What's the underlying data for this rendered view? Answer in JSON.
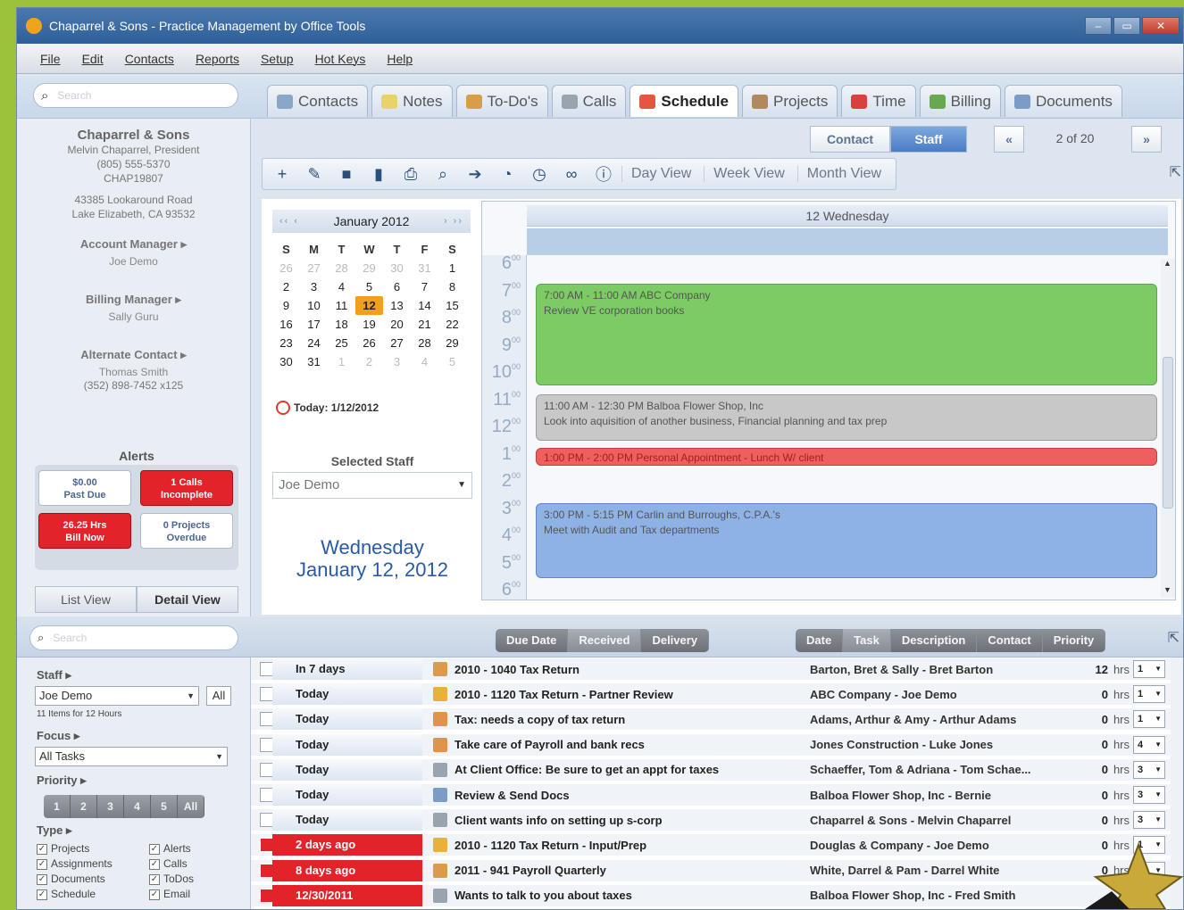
{
  "window": {
    "title": "Chaparrel & Sons - Practice Management by Office Tools"
  },
  "menu": [
    "File",
    "Edit",
    "Contacts",
    "Reports",
    "Setup",
    "Hot Keys",
    "Help"
  ],
  "search": {
    "placeholder": "Search"
  },
  "tabs": [
    {
      "label": "Contacts",
      "color": "#8aa7c8"
    },
    {
      "label": "Notes",
      "color": "#e8d36a"
    },
    {
      "label": "To-Do's",
      "color": "#d99c4a"
    },
    {
      "label": "Calls",
      "color": "#9aa4ae"
    },
    {
      "label": "Schedule",
      "color": "#e4563f",
      "active": true
    },
    {
      "label": "Projects",
      "color": "#b08a5a"
    },
    {
      "label": "Time",
      "color": "#d9413a"
    },
    {
      "label": "Billing",
      "color": "#6aa84f"
    },
    {
      "label": "Documents",
      "color": "#7a9cc6"
    }
  ],
  "contact": {
    "company": "Chaparrel & Sons",
    "person": "Melvin Chaparrel, President",
    "phone": "(805) 555-5370",
    "code": "CHAP19807",
    "address1": "43385 Lookaround Road",
    "address2": "Lake Elizabeth, CA 93532",
    "account_manager_label": "Account Manager ▸",
    "account_manager": "Joe Demo",
    "billing_manager_label": "Billing Manager ▸",
    "billing_manager": "Sally Guru",
    "alternate_label": "Alternate Contact ▸",
    "alternate_name": "Thomas Smith",
    "alternate_phone": "(352) 898-7452 x125"
  },
  "alerts": {
    "title": "Alerts",
    "past_due_amount": "$0.00",
    "past_due_label": "Past Due",
    "calls_count": "1 Calls",
    "calls_label": "Incomplete",
    "bill_hrs": "26.25 Hrs",
    "bill_label": "Bill Now",
    "projects_count": "0 Projects",
    "projects_label": "Overdue"
  },
  "views": {
    "list": "List View",
    "detail": "Detail View"
  },
  "schedule_toolbar": {
    "contact": "Contact",
    "staff": "Staff",
    "prev": "«",
    "next": "»",
    "pager": "2 of 20",
    "day_view": "Day View",
    "week_view": "Week View",
    "month_view": "Month View"
  },
  "calendar": {
    "month_label": "January 2012",
    "nav_prev": "‹‹ ‹",
    "nav_next": "› ››",
    "dow": [
      "S",
      "M",
      "T",
      "W",
      "T",
      "F",
      "S"
    ],
    "weeks": [
      [
        "26",
        "27",
        "28",
        "29",
        "30",
        "31",
        "1"
      ],
      [
        "2",
        "3",
        "4",
        "5",
        "6",
        "7",
        "8"
      ],
      [
        "9",
        "10",
        "11",
        "12",
        "13",
        "14",
        "15"
      ],
      [
        "16",
        "17",
        "18",
        "19",
        "20",
        "21",
        "22"
      ],
      [
        "23",
        "24",
        "25",
        "26",
        "27",
        "28",
        "29"
      ],
      [
        "30",
        "31",
        "1",
        "2",
        "3",
        "4",
        "5"
      ]
    ],
    "selected_day": "12",
    "today_label": "Today: 1/12/2012"
  },
  "selected_staff": {
    "label": "Selected Staff",
    "value": "Joe Demo"
  },
  "big_date": {
    "line1": "Wednesday",
    "line2": "January 12, 2012"
  },
  "day_view": {
    "header": "12 Wednesday",
    "hours": [
      "6",
      "7",
      "8",
      "9",
      "10",
      "11",
      "12",
      "1",
      "2",
      "3",
      "4",
      "5",
      "6"
    ],
    "appointments": [
      {
        "time": "7:00 AM - 11:00 AM ABC Company",
        "desc": "Review VE corporation books",
        "color": "green"
      },
      {
        "time": "11:00 AM - 12:30 PM Balboa Flower Shop, Inc",
        "desc": "Look into aquisition of another business, Financial planning and tax prep",
        "color": "gray"
      },
      {
        "time": "1:00 PM - 2:00 PM Personal Appointment - Lunch W/ client",
        "desc": "",
        "color": "red"
      },
      {
        "time": "3:00 PM - 5:15 PM Carlin and Burroughs, C.P.A.'s",
        "desc": "Meet with Audit and Tax departments",
        "color": "blue"
      }
    ]
  },
  "bottom_search": {
    "placeholder": "Search"
  },
  "sort_left": [
    "Due Date",
    "Received",
    "Delivery"
  ],
  "sort_right": [
    "Date",
    "Task",
    "Description",
    "Contact",
    "Priority"
  ],
  "filters": {
    "staff_label": "Staff ▸",
    "staff_value": "Joe Demo",
    "all": "All",
    "count_note": "11 Items for 12 Hours",
    "focus_label": "Focus ▸",
    "focus_value": "All Tasks",
    "priority_label": "Priority ▸",
    "priority_buttons": [
      "1",
      "2",
      "3",
      "4",
      "5",
      "All"
    ],
    "type_label": "Type ▸",
    "types": [
      "Projects",
      "Alerts",
      "Assignments",
      "Calls",
      "Documents",
      "ToDos",
      "Schedule",
      "Email"
    ]
  },
  "tasks": [
    {
      "when": "In 7 days",
      "task": "2010 - 1040 Tax Return",
      "contact": "Barton, Bret & Sally - Bret Barton",
      "hrs": "12",
      "unit": "hrs",
      "priority": "1",
      "late": false,
      "icon": "#d99c4a"
    },
    {
      "when": "Today",
      "task": "2010 - 1120 Tax Return - Partner Review",
      "contact": "ABC Company - Joe Demo",
      "hrs": "0",
      "unit": "hrs",
      "priority": "1",
      "late": false,
      "icon": "#e8b23a"
    },
    {
      "when": "Today",
      "task": "Tax: needs a copy of tax return",
      "contact": "Adams, Arthur & Amy - Arthur Adams",
      "hrs": "0",
      "unit": "hrs",
      "priority": "1",
      "late": false,
      "icon": "#e0934a"
    },
    {
      "when": "Today",
      "task": "Take care of Payroll and bank recs",
      "contact": "Jones Construction - Luke Jones",
      "hrs": "0",
      "unit": "hrs",
      "priority": "4",
      "late": false,
      "icon": "#e0934a"
    },
    {
      "when": "Today",
      "task": "At Client Office: Be sure to get an appt for taxes",
      "contact": "Schaeffer, Tom & Adriana - Tom Schae...",
      "hrs": "0",
      "unit": "hrs",
      "priority": "3",
      "late": false,
      "icon": "#9aa4ae"
    },
    {
      "when": "Today",
      "task": "Review & Send Docs",
      "contact": "Balboa Flower Shop, Inc - Bernie",
      "hrs": "0",
      "unit": "hrs",
      "priority": "3",
      "late": false,
      "icon": "#7a9cc6"
    },
    {
      "when": "Today",
      "task": "Client wants info on setting up s-corp",
      "contact": "Chaparrel & Sons - Melvin Chaparrel",
      "hrs": "0",
      "unit": "hrs",
      "priority": "3",
      "late": false,
      "icon": "#9aa4ae"
    },
    {
      "when": "2 days ago",
      "task": "2010 - 1120 Tax Return - Input/Prep",
      "contact": "Douglas & Company - Joe Demo",
      "hrs": "0",
      "unit": "hrs",
      "priority": "1",
      "late": true,
      "icon": "#e8b23a"
    },
    {
      "when": "8 days ago",
      "task": "2011 - 941 Payroll Quarterly",
      "contact": "White, Darrel & Pam - Darrel White",
      "hrs": "0",
      "unit": "hrs",
      "priority": "1",
      "late": true,
      "icon": "#d99c4a"
    },
    {
      "when": "12/30/2011",
      "task": "Wants to talk to you about taxes",
      "contact": "Balboa Flower Shop, Inc - Fred Smith",
      "hrs": "",
      "unit": "",
      "priority": "",
      "late": true,
      "icon": "#9aa4ae"
    }
  ]
}
